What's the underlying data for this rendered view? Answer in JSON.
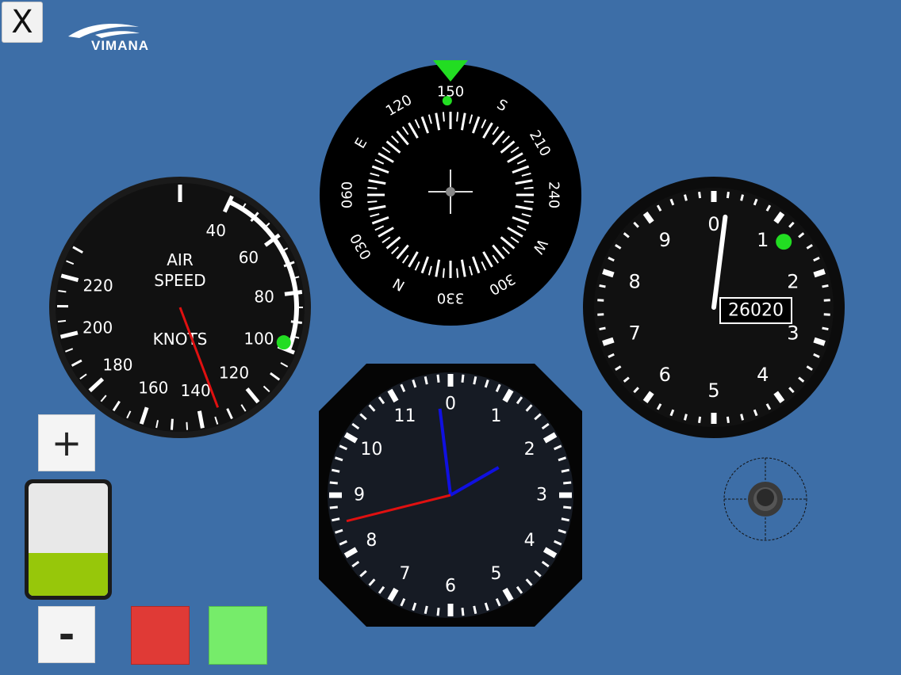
{
  "app": {
    "close_label": "X",
    "logo_text": "VIMANA",
    "plus_label": "+",
    "minus_label": "-"
  },
  "colors": {
    "background": "#3d6ea7",
    "red_button": "#e03a36",
    "green_button": "#76ec6a",
    "throttle_fill": "#97c70a",
    "indicator_green": "#22dd22",
    "airspeed_needle": "#e01010",
    "clock_hour_hand": "#1010e0",
    "clock_second_hand": "#e01010"
  },
  "throttle": {
    "level_fraction": 0.38
  },
  "airspeed": {
    "title_line1": "AIR",
    "title_line2": "SPEED",
    "unit": "KNOTS",
    "labels": [
      "40",
      "60",
      "80",
      "100",
      "120",
      "140",
      "160",
      "180",
      "200",
      "220"
    ],
    "needle_value": 133
  },
  "heading": {
    "labels": [
      "150",
      "S",
      "210",
      "240",
      "W",
      "300",
      "330",
      "N",
      "030",
      "060",
      "E",
      "120"
    ],
    "heading_deg": 150
  },
  "altimeter": {
    "labels": [
      "0",
      "1",
      "2",
      "3",
      "4",
      "5",
      "6",
      "7",
      "8",
      "9"
    ],
    "readout": "26020",
    "hand_value": 0.2
  },
  "clock": {
    "labels": [
      "0",
      "1",
      "2",
      "3",
      "4",
      "5",
      "6",
      "7",
      "8",
      "9",
      "10",
      "11"
    ],
    "hour_value": 2.0,
    "minute_value": 59,
    "second_value": 44
  },
  "icons": {
    "close": "close-icon",
    "joystick": "joystick-icon",
    "logo": "vimana-logo-icon"
  }
}
